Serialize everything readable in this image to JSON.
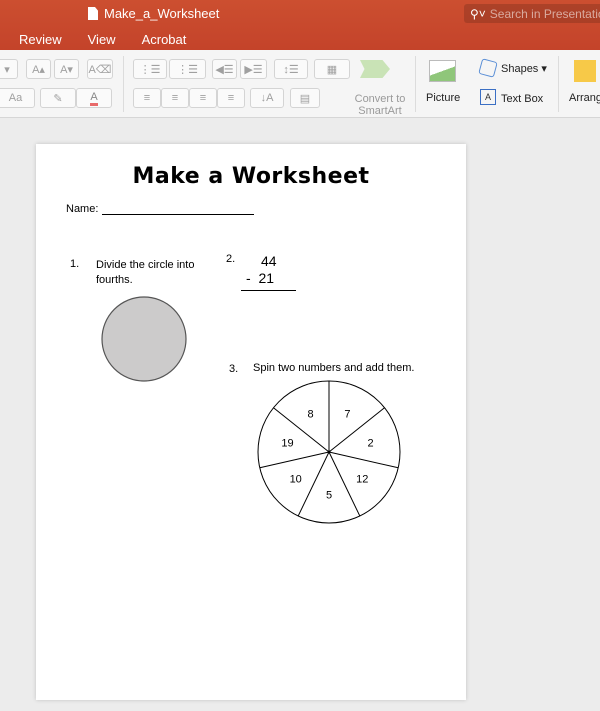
{
  "window": {
    "doc_title": "Make_a_Worksheet",
    "search_placeholder": "Search in Presentation"
  },
  "tabs": [
    {
      "label": "Review"
    },
    {
      "label": "View"
    },
    {
      "label": "Acrobat"
    }
  ],
  "ribbon": {
    "convert_smartart_line1": "Convert to",
    "convert_smartart_line2": "SmartArt",
    "picture_label": "Picture",
    "shapes_label": "Shapes",
    "textbox_label": "Text Box",
    "arrange_label": "Arrange"
  },
  "worksheet": {
    "title": "Make a Worksheet",
    "name_label": "Name:",
    "q1": {
      "number": "1.",
      "text_line1": "Divide the circle into",
      "text_line2": "fourths."
    },
    "q2": {
      "number": "2.",
      "top": "44",
      "bottom": "-  21"
    },
    "q3": {
      "number": "3.",
      "text": "Spin two numbers and add them."
    },
    "spinner_numbers": [
      "8",
      "7",
      "2",
      "12",
      "5",
      "10",
      "19"
    ],
    "circle_color": "#cccbcb"
  },
  "colors": {
    "accent": "#c94a2c"
  }
}
